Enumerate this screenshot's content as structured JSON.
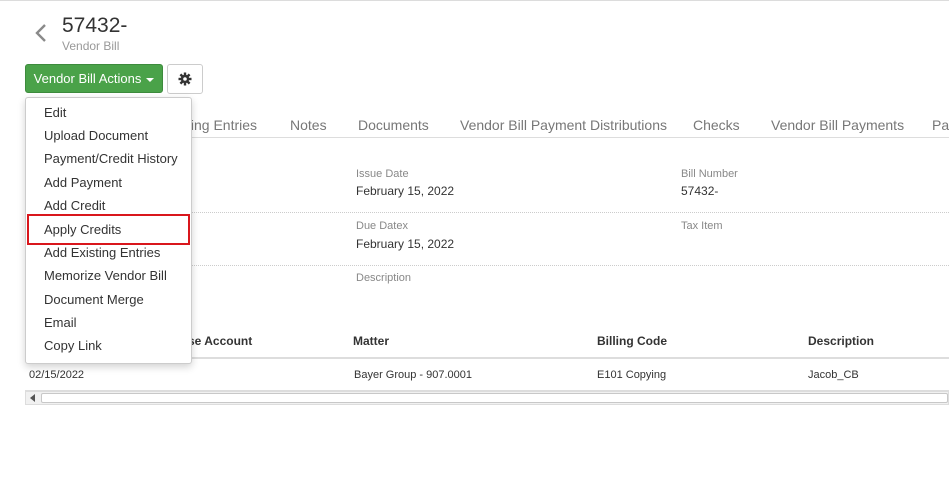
{
  "header": {
    "title": "57432-",
    "subtitle": "Vendor Bill"
  },
  "toolbar": {
    "actions_label": "Vendor Bill Actions"
  },
  "tabs": [
    {
      "label": "ting Entries"
    },
    {
      "label": "Notes"
    },
    {
      "label": "Documents"
    },
    {
      "label": "Vendor Bill Payment Distributions"
    },
    {
      "label": "Checks"
    },
    {
      "label": "Vendor Bill Payments"
    },
    {
      "label": "Pa"
    }
  ],
  "details": {
    "issue_date_label": "Issue Date",
    "issue_date_value": "February 15, 2022",
    "bill_number_label": "Bill Number",
    "bill_number_value": "57432-",
    "due_date_label": "Due Datex",
    "due_date_value": "February 15, 2022",
    "tax_item_label": "Tax Item",
    "description_label": "Description"
  },
  "table": {
    "headers": [
      "se Account",
      "Matter",
      "Billing Code",
      "Description"
    ],
    "rows": [
      {
        "date": "02/15/2022",
        "matter": "Bayer Group - 907.0001",
        "billing_code": "E101 Copying",
        "description": "Jacob_CB"
      }
    ]
  },
  "menu": {
    "items": [
      {
        "label": "Edit"
      },
      {
        "label": "Upload Document"
      },
      {
        "label": "Payment/Credit History"
      },
      {
        "label": "Add Payment"
      },
      {
        "label": "Add Credit"
      },
      {
        "label": "Apply Credits"
      },
      {
        "label": "Add Existing Entries"
      },
      {
        "label": "Memorize Vendor Bill"
      },
      {
        "label": "Document Merge"
      },
      {
        "label": "Email"
      },
      {
        "label": "Copy Link"
      }
    ],
    "highlighted": "Apply Credits"
  },
  "colors": {
    "accent": "#4aa249",
    "highlight": "#d9161c"
  }
}
